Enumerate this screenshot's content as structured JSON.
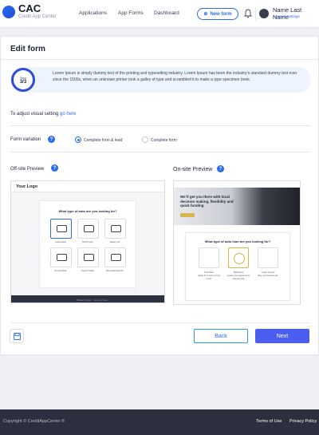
{
  "header": {
    "brand": "CAC",
    "brand_sub": "Credit App Center",
    "nav": [
      "Applications",
      "App Forms",
      "Dashboard"
    ],
    "new_form": "New form",
    "user_name": "Name Last Name",
    "account_settings": "Account Settings"
  },
  "page": {
    "title": "Edit form",
    "step_label": "Step",
    "step_value": "3/3",
    "info_text": "Lorem Ipsum is simply dummy text of the printing and typesetting industry. Lorem Ipsum has been the industry's standard dummy text ever since the 1500s, when an unknown printer took a galley of type and scrambled it to make a type specimen book.",
    "adjust_text": "To adjust visual setting",
    "adjust_link": "go here",
    "form_variation_label": "Form variation",
    "option_1": "Complete form & lead",
    "option_2": "Complete form",
    "offsite_label": "Off-site Preview",
    "onsite_label": "On-site Preview",
    "progress": 1.0
  },
  "offsite": {
    "logo": "Your Logo",
    "question": "What type of auto are you looking for?",
    "tiles": [
      "Automobile",
      "Motorcycle",
      "Heavy Lift",
      "Snowmobile",
      "Travel Trailer",
      "Recreational/ATV"
    ],
    "footer_left": "Privacy Policy",
    "footer_right": "Terms of Use"
  },
  "onsite": {
    "hero_text": "We`ll get you there with local decision making, flexibility and quick funding",
    "question": "What type of auto loan are you looking for?",
    "tiles": [
      "Purchase",
      "Refinance",
      "Lease buyout"
    ],
    "tile_subs": [
      "Apply for a loan to buy a car",
      "Lower your payment or interest rate",
      "Buy your leased car"
    ]
  },
  "actions": {
    "back": "Back",
    "next": "Next"
  },
  "footer": {
    "copyright": "Copyright © CreditAppCenter ®",
    "terms": "Terms of Use",
    "privacy": "Privacy Policy"
  }
}
